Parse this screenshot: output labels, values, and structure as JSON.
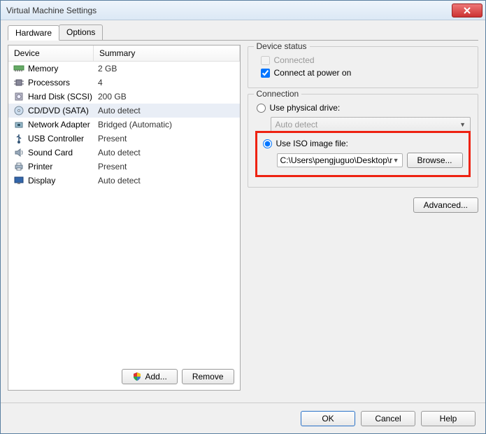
{
  "window": {
    "title": "Virtual Machine Settings"
  },
  "tabs": {
    "hardware": "Hardware",
    "options": "Options"
  },
  "columns": {
    "device": "Device",
    "summary": "Summary"
  },
  "devices": [
    {
      "icon": "memory",
      "name": "Memory",
      "summary": "2 GB"
    },
    {
      "icon": "cpu",
      "name": "Processors",
      "summary": "4"
    },
    {
      "icon": "hdd",
      "name": "Hard Disk (SCSI)",
      "summary": "200 GB"
    },
    {
      "icon": "cd",
      "name": "CD/DVD (SATA)",
      "summary": "Auto detect",
      "selected": true
    },
    {
      "icon": "net",
      "name": "Network Adapter",
      "summary": "Bridged (Automatic)"
    },
    {
      "icon": "usb",
      "name": "USB Controller",
      "summary": "Present"
    },
    {
      "icon": "sound",
      "name": "Sound Card",
      "summary": "Auto detect"
    },
    {
      "icon": "printer",
      "name": "Printer",
      "summary": "Present"
    },
    {
      "icon": "display",
      "name": "Display",
      "summary": "Auto detect"
    }
  ],
  "leftButtons": {
    "add": "Add...",
    "remove": "Remove"
  },
  "status": {
    "groupTitle": "Device status",
    "connected": "Connected",
    "connectOnPowerOn": "Connect at power on"
  },
  "connection": {
    "groupTitle": "Connection",
    "usePhysical": "Use physical drive:",
    "physicalValue": "Auto detect",
    "useIso": "Use ISO image file:",
    "isoPath": "C:\\Users\\pengjuguo\\Desktop\\rhel-s",
    "browse": "Browse..."
  },
  "advanced": "Advanced...",
  "footer": {
    "ok": "OK",
    "cancel": "Cancel",
    "help": "Help"
  }
}
